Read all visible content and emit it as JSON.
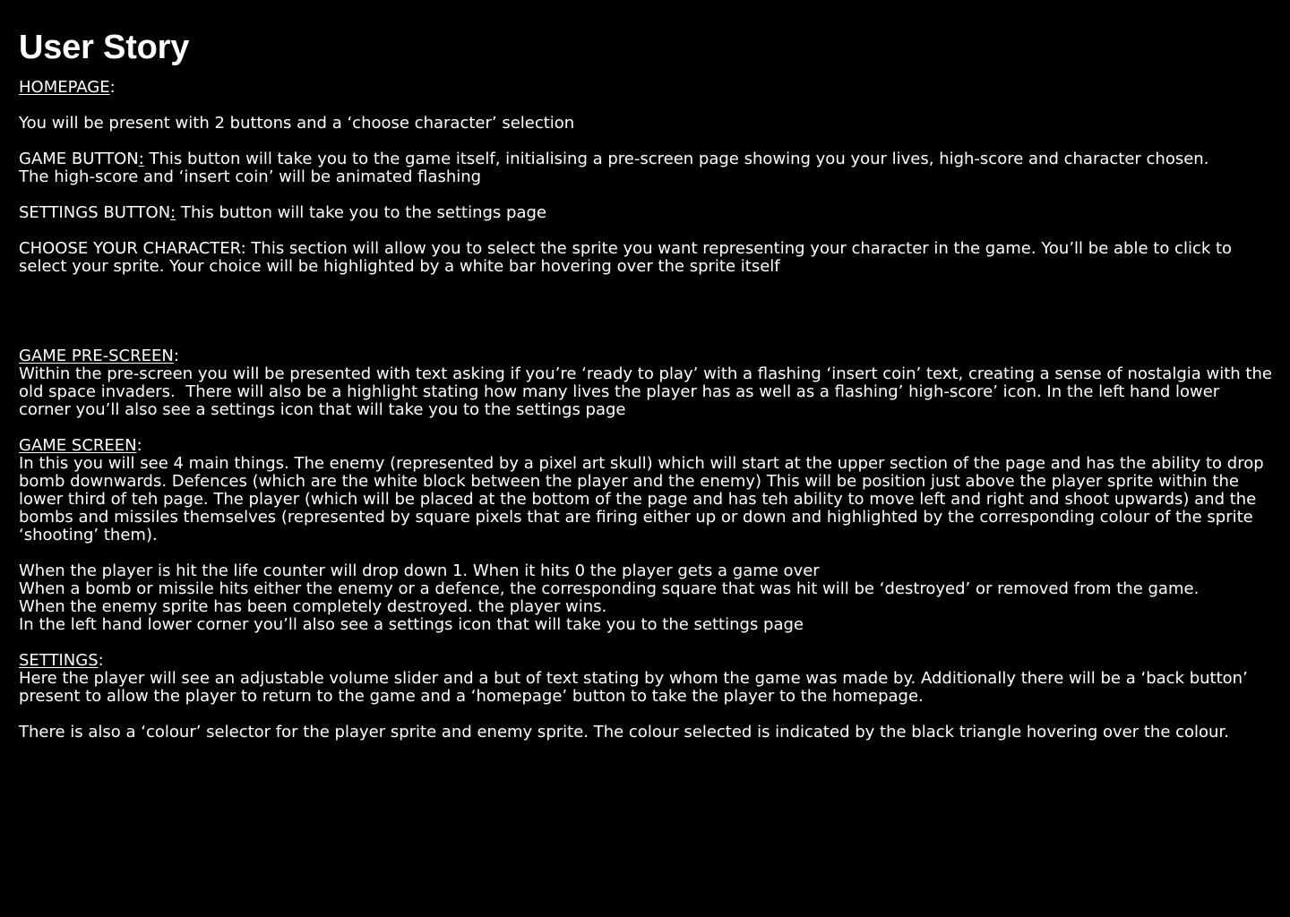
{
  "title": "User Story",
  "homepage": {
    "heading": "HOMEPAGE",
    "intro": "You will be present with 2 buttons and a ‘choose character’ selection",
    "game_button_label": "GAME BUTTON",
    "game_button_text": " This button will take you to the game itself, initialising a pre-screen page showing you your lives, high-score and character chosen.\nThe high-score and ‘insert coin’ will be animated flashing",
    "settings_button_label": "SETTINGS BUTTON",
    "settings_button_text": " This button will take you to the settings page",
    "choose_character_label": "CHOOSE YOUR CHARACTER:",
    "choose_character_text": " This section will allow you to select the sprite you want representing your character in the game. You’ll be able to click to select your sprite. Your choice will be highlighted by a white bar hovering over the sprite itself"
  },
  "pre_screen": {
    "heading": "GAME PRE-SCREEN",
    "text": "Within the pre-screen you will be presented with text asking if you’re ‘ready to play’ with a flashing ‘insert coin’ text, creating a sense of nostalgia with the old space invaders.  There will also be a highlight stating how many lives the player has as well as a flashing’ high-score’ icon. In the left hand lower corner you’ll also see a settings icon that will take you to the settings page"
  },
  "game_screen": {
    "heading": "GAME SCREEN",
    "text": "In this you will see 4 main things. The enemy (represented by a pixel art skull) which will start at the upper section of the page and has the ability to drop bomb downwards. Defences (which are the white block between the player and the enemy) This will be position just above the player sprite within the lower third of teh page. The player (which will be placed at the bottom of the page and has teh ability to move left and right and shoot upwards) and the bombs and missiles themselves (represented by square pixels that are firing either up or down and highlighted by the corresponding colour of the sprite ‘shooting’ them).",
    "rules": "When the player is hit the life counter will drop down 1. When it hits 0 the player gets a game over\nWhen a bomb or missile hits either the enemy or a defence, the corresponding square that was hit will be ‘destroyed’ or removed from the game.\nWhen the enemy sprite has been completely destroyed. the player wins.\nIn the left hand lower corner you’ll also see a settings icon that will take you to the settings page"
  },
  "settings": {
    "heading": "SETTINGS",
    "text": "Here the player will see an adjustable volume slider and a but of text stating by whom the game was made by. Additionally there will be a ‘back button’ present to allow the player to return to the game and a ‘homepage’ button to take the player to the homepage.",
    "colour_text": "There is also a ‘colour’ selector for the player sprite and enemy sprite. The colour selected is indicated by the black triangle hovering over the colour."
  }
}
